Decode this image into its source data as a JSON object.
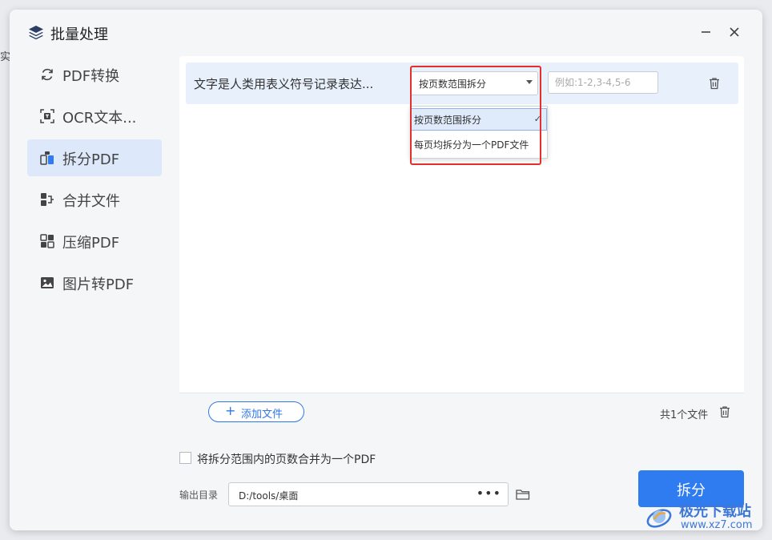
{
  "edge_text": "实信",
  "window": {
    "title": "批量处理",
    "icon": "layers-icon",
    "minimize_icon": "minimize-icon",
    "close_icon": "close-icon"
  },
  "sidebar": {
    "items": [
      {
        "label": "PDF转换",
        "icon": "refresh-icon",
        "active": false
      },
      {
        "label": "OCR文本...",
        "icon": "ocr-icon",
        "active": false
      },
      {
        "label": "拆分PDF",
        "icon": "split-icon",
        "active": true
      },
      {
        "label": "合并文件",
        "icon": "merge-icon",
        "active": false
      },
      {
        "label": "压缩PDF",
        "icon": "compress-icon",
        "active": false
      },
      {
        "label": "图片转PDF",
        "icon": "image-icon",
        "active": false
      }
    ]
  },
  "file_row": {
    "name": "文字是人类用表义符号记录表达...",
    "split_mode": "按页数范围拆分",
    "range_placeholder": "例如:1-2,3-4,5-6",
    "range_value": ""
  },
  "dropdown": {
    "options": [
      {
        "label": "按页数范围拆分",
        "selected": true
      },
      {
        "label": "每页均拆分为一个PDF文件",
        "selected": false
      }
    ],
    "check_glyph": "✓"
  },
  "footer": {
    "add_label": "添加文件",
    "add_plus": "+",
    "file_count": "共1个文件"
  },
  "merge_option": {
    "label": "将拆分范围内的页数合并为一个PDF",
    "checked": false
  },
  "output": {
    "label": "输出目录",
    "path": "D:/tools/桌面",
    "more": "•••"
  },
  "action": {
    "label": "拆分"
  },
  "watermark": {
    "title": "极光下载站",
    "url": "www.xz7.com"
  },
  "colors": {
    "accent": "#2f7bf0",
    "highlight": "#e2302c",
    "active_bg": "#dde9fb",
    "row_bg": "#e8f0fc"
  }
}
